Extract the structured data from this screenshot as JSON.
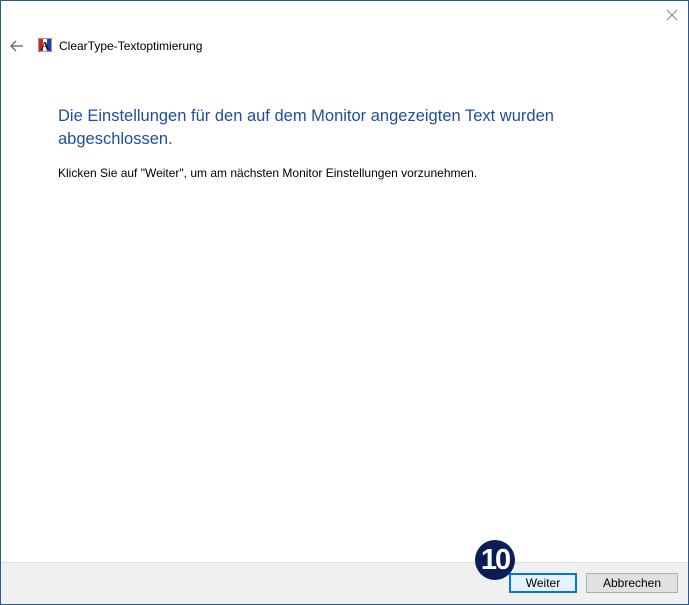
{
  "window": {
    "close_icon": "close-icon",
    "accent_color": "#2b5797"
  },
  "header": {
    "back_icon": "back-arrow-icon",
    "app_icon": "cleartype-icon",
    "title": "ClearType-Textoptimierung"
  },
  "content": {
    "heading": "Die Einstellungen für den auf dem Monitor angezeigten Text wurden abgeschlossen.",
    "heading_color": "#1f4e9c",
    "instruction": "Klicken Sie auf \"Weiter\", um am nächsten Monitor Einstellungen vorzunehmen."
  },
  "footer": {
    "next_label": "Weiter",
    "cancel_label": "Abbrechen"
  },
  "annotation": {
    "step_number": "10",
    "badge_color": "#0b1d57"
  }
}
